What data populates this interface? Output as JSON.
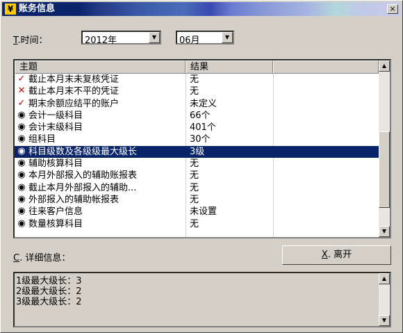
{
  "window": {
    "title": "账务信息",
    "close_glyph": "×"
  },
  "time_filter": {
    "label_key": "T",
    "label_rest": ".时间：",
    "year_value": "2012年",
    "month_value": "06月"
  },
  "table": {
    "columns": [
      "主题",
      "结果"
    ],
    "rows": [
      {
        "icon": "check-icon",
        "subject": "截止本月末未复核凭证",
        "result": "无",
        "selected": false
      },
      {
        "icon": "cross-icon",
        "subject": "截止本月末不平的凭证",
        "result": "无",
        "selected": false
      },
      {
        "icon": "check-icon",
        "subject": "期末余额应结平的账户",
        "result": "未定义",
        "selected": false
      },
      {
        "icon": "eye-icon",
        "subject": "会计一级科目",
        "result": "66个",
        "selected": false
      },
      {
        "icon": "eye-icon",
        "subject": "会计末级科目",
        "result": "401个",
        "selected": false
      },
      {
        "icon": "eye-icon",
        "subject": "组科目",
        "result": "30个",
        "selected": false
      },
      {
        "icon": "eye-icon",
        "subject": "科目级数及各级级最大级长",
        "result": "3级",
        "selected": true
      },
      {
        "icon": "eye-icon",
        "subject": "辅助核算科目",
        "result": "无",
        "selected": false
      },
      {
        "icon": "eye-icon",
        "subject": "本月外部报入的辅助账报表",
        "result": "无",
        "selected": false
      },
      {
        "icon": "eye-icon",
        "subject": "截止本月外部报入的辅助...",
        "result": "无",
        "selected": false
      },
      {
        "icon": "eye-icon",
        "subject": "外部报入的辅助帐报表",
        "result": "无",
        "selected": false
      },
      {
        "icon": "eye-icon",
        "subject": "往来客户信息",
        "result": "未设置",
        "selected": false
      },
      {
        "icon": "eye-icon",
        "subject": "数量核算科目",
        "result": "无",
        "selected": false
      }
    ]
  },
  "detail": {
    "label_key": "C",
    "label_rest": ". 详细信息：",
    "text": "1级最大级长：3\n2级最大级长：2\n3级最大级长：2"
  },
  "exit_button": {
    "label_key": "X",
    "label_rest": ". 离开"
  },
  "icons": {
    "check": "✓",
    "cross": "✕",
    "eye": "◉",
    "up": "▲",
    "down": "▼"
  }
}
